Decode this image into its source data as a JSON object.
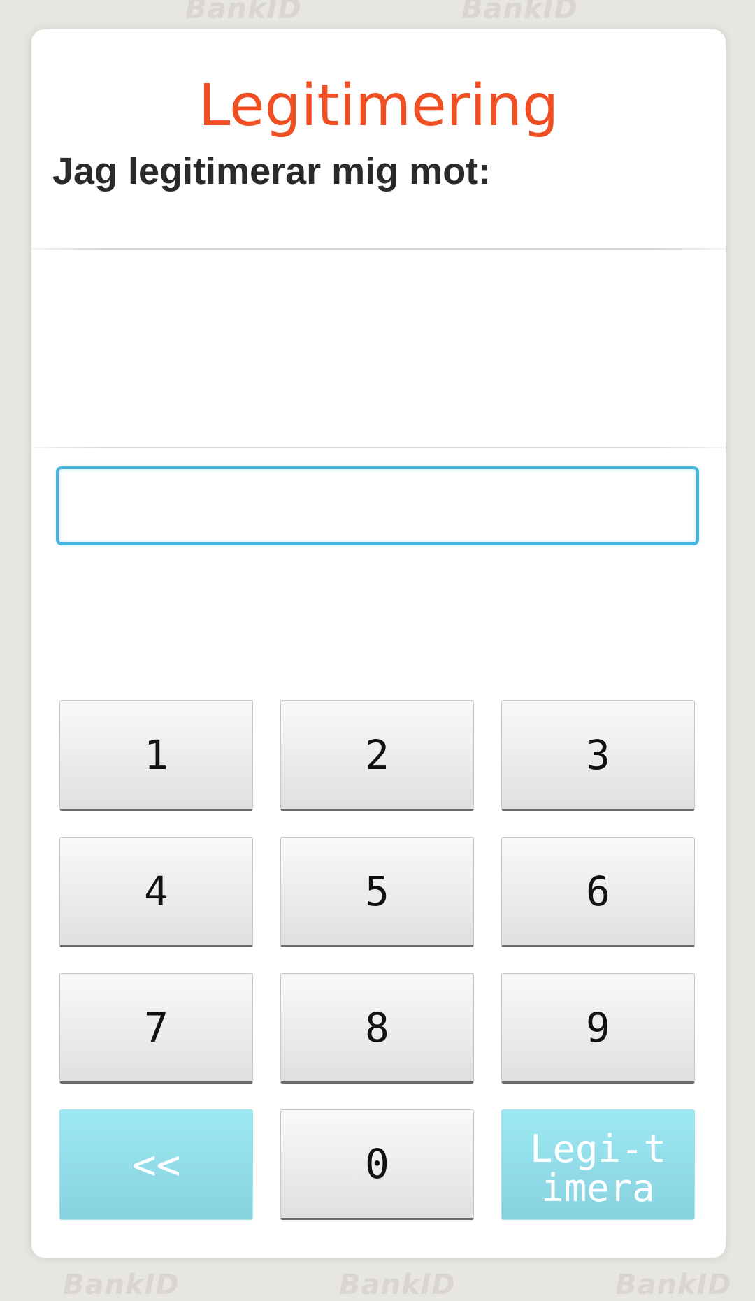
{
  "background": {
    "watermark_text": "BankID"
  },
  "dialog": {
    "title": "Legitimering",
    "subtitle": "Jag legitimerar mig mot:",
    "message": ""
  },
  "pin_field": {
    "value": "",
    "placeholder": ""
  },
  "keypad": {
    "keys": [
      "1",
      "2",
      "3",
      "4",
      "5",
      "6",
      "7",
      "8",
      "9"
    ],
    "backspace_label": "<<",
    "zero_label": "0",
    "submit_label": "Legi-timera"
  },
  "colors": {
    "title": "#f04e23",
    "input_border": "#45b6df",
    "action_key": "#8fdbe7"
  }
}
